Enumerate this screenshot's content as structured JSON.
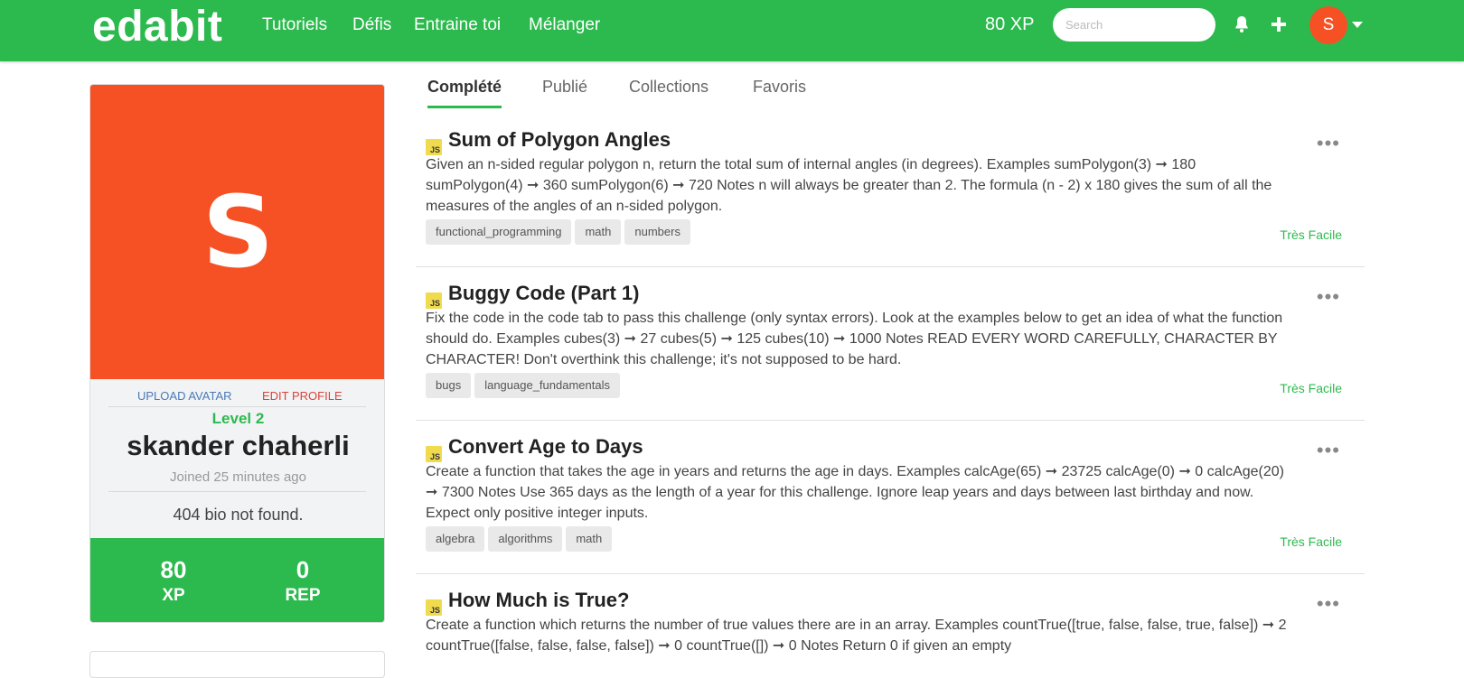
{
  "nav": {
    "logo": "edabit",
    "links": [
      "Tutoriels",
      "Défis",
      "Entraine toi",
      "Mélanger"
    ],
    "xp": "80 XP",
    "search_placeholder": "Search",
    "avatar_letter": "S"
  },
  "profile": {
    "avatar_letter": "S",
    "upload_avatar": "UPLOAD AVATAR",
    "edit_profile": "EDIT PROFILE",
    "level": "Level 2",
    "name": "skander chaherli",
    "joined": "Joined 25 minutes ago",
    "bio": "404 bio not found.",
    "xp_value": "80",
    "xp_label": "XP",
    "rep_value": "0",
    "rep_label": "REP"
  },
  "tabs": [
    "Complété",
    "Publié",
    "Collections",
    "Favoris"
  ],
  "challenges": [
    {
      "title": "Sum of Polygon Angles",
      "description": "Given an n-sided regular polygon n, return the total sum of internal angles (in degrees). Examples sumPolygon(3) ➞ 180 sumPolygon(4) ➞ 360 sumPolygon(6) ➞ 720 Notes n will always be greater than 2. The formula (n - 2) x 180 gives the sum of all the measures of the angles of an n-sided polygon.",
      "tags": [
        "functional_programming",
        "math",
        "numbers"
      ],
      "difficulty": "Très Facile"
    },
    {
      "title": "Buggy Code (Part 1)",
      "description": "Fix the code in the code tab to pass this challenge (only syntax errors). Look at the examples below to get an idea of what the function should do. Examples cubes(3) ➞ 27 cubes(5) ➞ 125 cubes(10) ➞ 1000 Notes READ EVERY WORD CAREFULLY, CHARACTER BY CHARACTER! Don't overthink this challenge; it's not supposed to be hard.",
      "tags": [
        "bugs",
        "language_fundamentals"
      ],
      "difficulty": "Très Facile"
    },
    {
      "title": "Convert Age to Days",
      "description": "Create a function that takes the age in years and returns the age in days. Examples calcAge(65) ➞ 23725 calcAge(0) ➞ 0 calcAge(20) ➞ 7300 Notes Use 365 days as the length of a year for this challenge. Ignore leap years and days between last birthday and now. Expect only positive integer inputs.",
      "tags": [
        "algebra",
        "algorithms",
        "math"
      ],
      "difficulty": "Très Facile"
    },
    {
      "title": "How Much is True?",
      "description": "Create a function which returns the number of true values there are in an array. Examples countTrue([true, false, false, true, false]) ➞ 2 countTrue([false, false, false, false]) ➞ 0 countTrue([]) ➞ 0 Notes Return 0 if given an empty",
      "tags": [],
      "difficulty": ""
    }
  ],
  "js_badge": "JS",
  "more_glyph": "•••"
}
